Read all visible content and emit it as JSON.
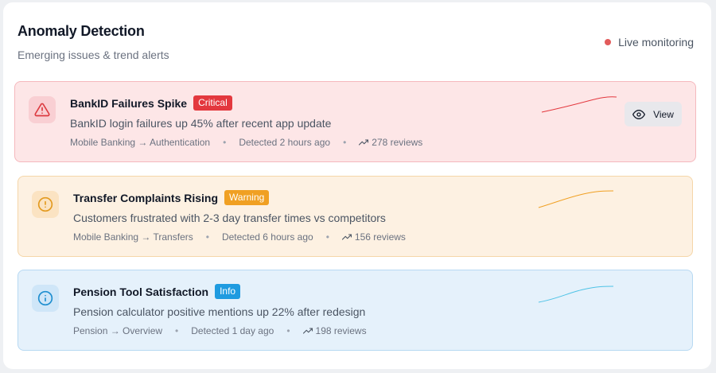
{
  "header": {
    "title": "Anomaly Detection",
    "subtitle": "Emerging issues & trend alerts",
    "live_label": "Live monitoring"
  },
  "alerts": [
    {
      "severity": "critical",
      "icon": "warning-triangle-icon",
      "title": "BankID Failures Spike",
      "badge": "Critical",
      "description": "BankID login failures up 45% after recent app update",
      "path": "Mobile Banking → Authentication",
      "detected": "Detected 2 hours ago",
      "reviews": "278 reviews",
      "action_label": "View",
      "color": "#e3383e"
    },
    {
      "severity": "warning",
      "icon": "alert-circle-icon",
      "title": "Transfer Complaints Rising",
      "badge": "Warning",
      "description": "Customers frustrated with 2-3 day transfer times vs competitors",
      "path": "Mobile Banking → Transfers",
      "detected": "Detected 6 hours ago",
      "reviews": "156 reviews",
      "color": "#f0a023"
    },
    {
      "severity": "info",
      "icon": "info-circle-icon",
      "title": "Pension Tool Satisfaction",
      "badge": "Info",
      "description": "Pension calculator positive mentions up 22% after redesign",
      "path": "Pension → Overview",
      "detected": "Detected 1 day ago",
      "reviews": "198 reviews",
      "color": "#1f9be0"
    }
  ]
}
